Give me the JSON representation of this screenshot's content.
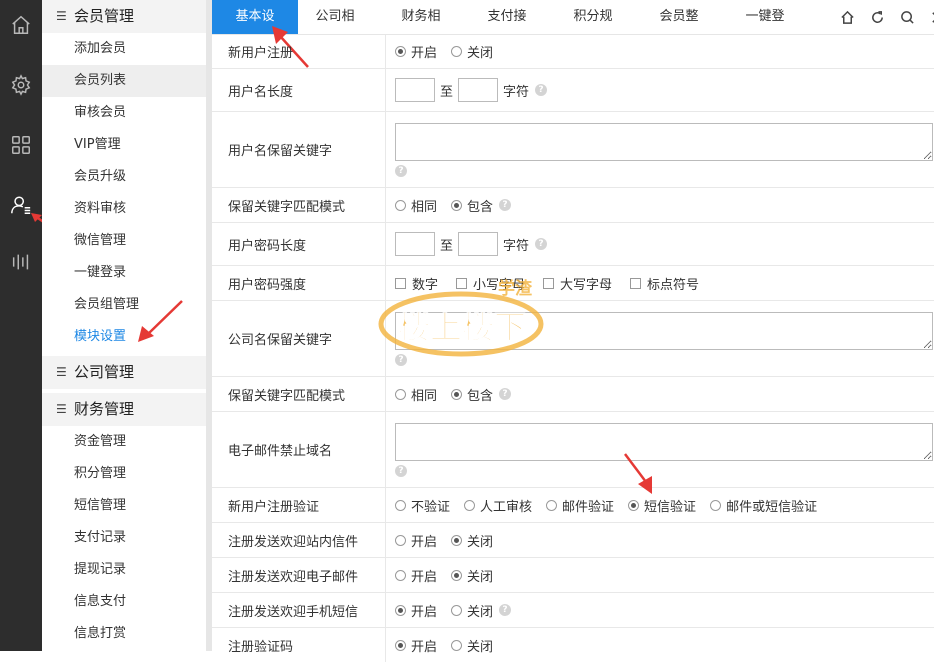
{
  "rail": {
    "icons": [
      "home-icon",
      "gear-icon",
      "grid-icon",
      "user-list-icon",
      "bars-icon"
    ]
  },
  "sidebar": {
    "groups": [
      {
        "label": "会员管理",
        "items": [
          "添加会员",
          "会员列表",
          "审核会员",
          "VIP管理",
          "会员升级",
          "资料审核",
          "微信管理",
          "一键登录",
          "会员组管理",
          "模块设置"
        ]
      },
      {
        "label": "公司管理",
        "items": []
      },
      {
        "label": "财务管理",
        "items": [
          "资金管理",
          "积分管理",
          "短信管理",
          "支付记录",
          "提现记录",
          "信息支付",
          "信息打赏"
        ]
      }
    ]
  },
  "tabs": [
    "基本设",
    "公司相",
    "财务相",
    "支付接",
    "积分规",
    "会员整",
    "一键登"
  ],
  "form": {
    "rows": [
      {
        "label": "新用户注册",
        "options": [
          "开启",
          "关闭"
        ],
        "selected": 0
      },
      {
        "label": "用户名长度",
        "sep": "至",
        "unit": "字符"
      },
      {
        "label": "用户名保留关键字"
      },
      {
        "label": "保留关键字匹配模式",
        "options": [
          "相同",
          "包含"
        ],
        "selected": 1
      },
      {
        "label": "用户密码长度",
        "sep": "至",
        "unit": "字符"
      },
      {
        "label": "用户密码强度",
        "checks": [
          "数字",
          "小写字母",
          "大写字母",
          "标点符号"
        ]
      },
      {
        "label": "公司名保留关键字"
      },
      {
        "label": "保留关键字匹配模式",
        "options": [
          "相同",
          "包含"
        ],
        "selected": 1
      },
      {
        "label": "电子邮件禁止域名"
      },
      {
        "label": "新用户注册验证",
        "options": [
          "不验证",
          "人工审核",
          "邮件验证",
          "短信验证",
          "邮件或短信验证"
        ],
        "selected": 3
      },
      {
        "label": "注册发送欢迎站内信件",
        "options": [
          "开启",
          "关闭"
        ],
        "selected": 1
      },
      {
        "label": "注册发送欢迎电子邮件",
        "options": [
          "开启",
          "关闭"
        ],
        "selected": 1
      },
      {
        "label": "注册发送欢迎手机短信",
        "options": [
          "开启",
          "关闭"
        ],
        "selected": 0
      },
      {
        "label": "注册验证码",
        "options": [
          "开启",
          "关闭"
        ],
        "selected": 0
      }
    ]
  },
  "watermark": {
    "line1": "学渣",
    "line2": "楼上楼下"
  },
  "colors": {
    "accent": "#1e88e5",
    "rail": "#2d2d2d",
    "arrow": "#e53935"
  }
}
